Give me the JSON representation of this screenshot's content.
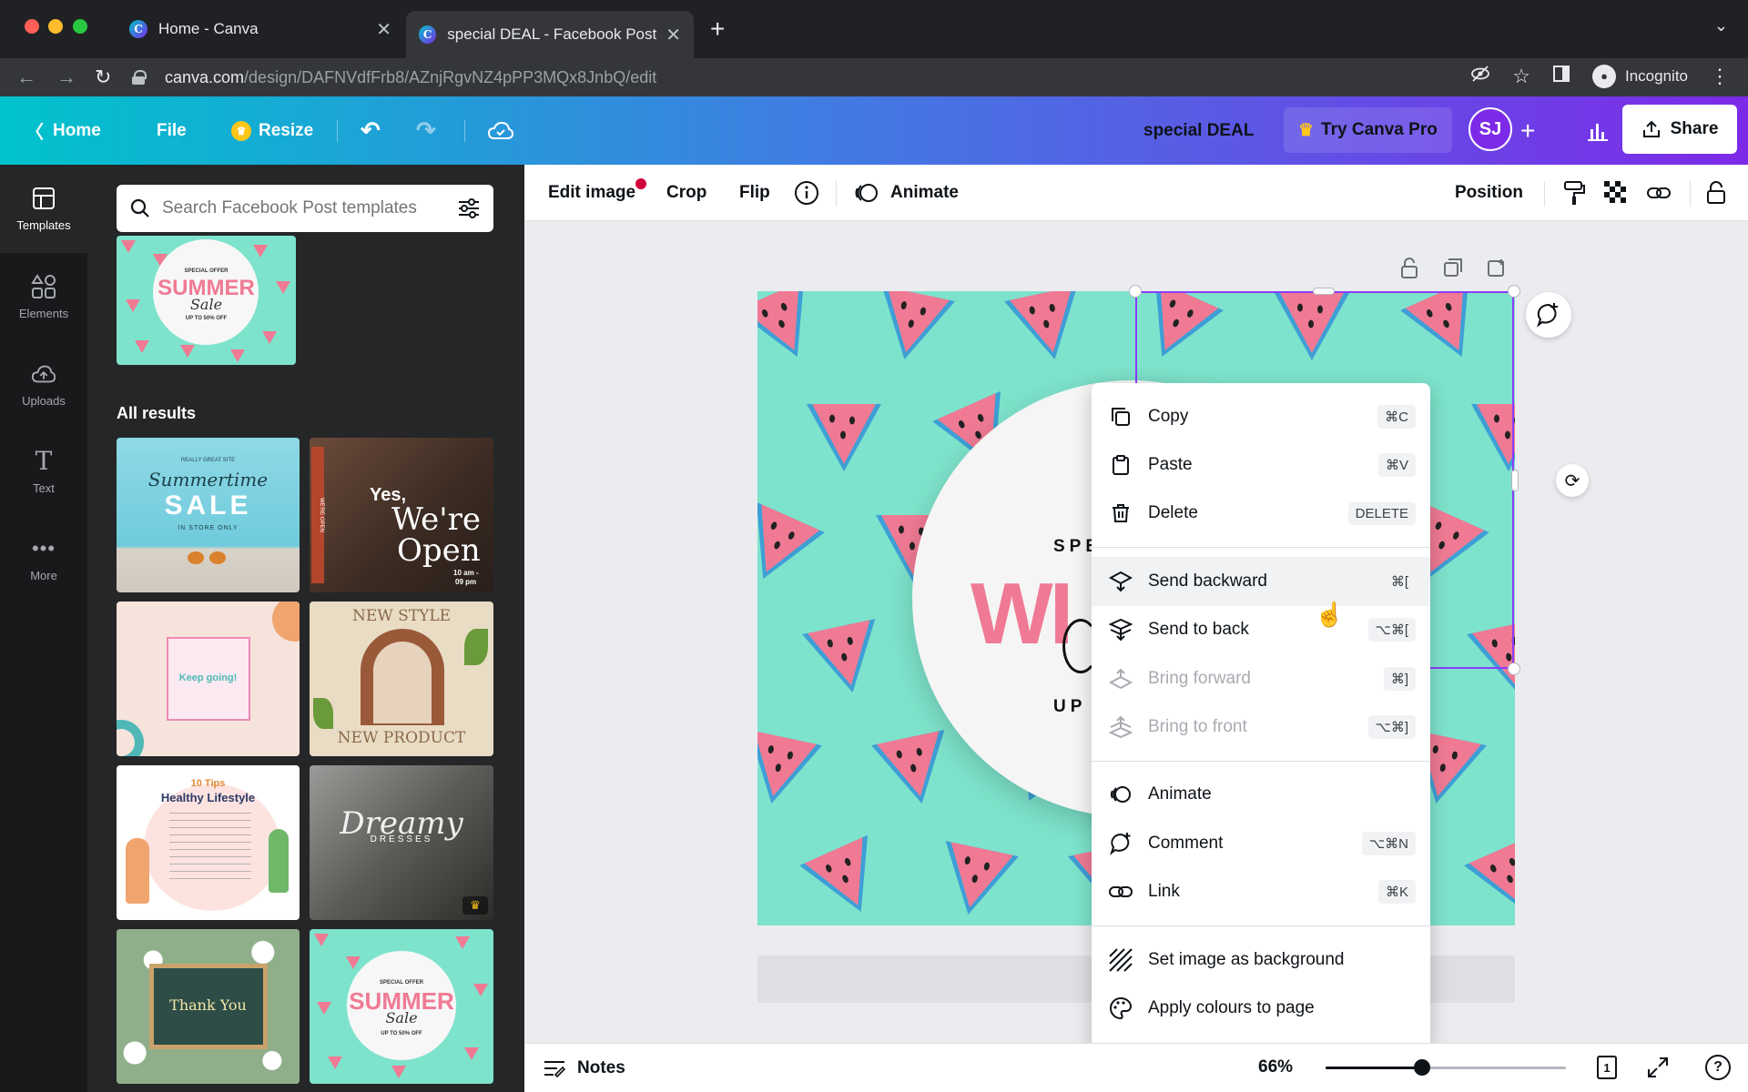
{
  "browser": {
    "tabs": [
      {
        "title": "Home - Canva",
        "active": false
      },
      {
        "title": "special DEAL - Facebook Post",
        "active": true
      }
    ],
    "url_host": "canva.com",
    "url_path": "/design/DAFNVdfFrb8/AZnjRgvNZ4pPP3MQx8JnbQ/edit",
    "profile_label": "Incognito",
    "colors": {
      "chrome_bg": "#202124",
      "chrome_tab": "#35363a"
    }
  },
  "header": {
    "home": "Home",
    "file": "File",
    "resize": "Resize",
    "design_title": "special DEAL",
    "try_pro": "Try Canva Pro",
    "avatar_initials": "SJ",
    "share": "Share",
    "gradient": [
      "#00c3cc",
      "#7d2ae8"
    ]
  },
  "rail": {
    "items": [
      {
        "label": "Templates",
        "icon": "templates-icon",
        "active": true
      },
      {
        "label": "Elements",
        "icon": "elements-icon",
        "active": false
      },
      {
        "label": "Uploads",
        "icon": "uploads-icon",
        "active": false
      },
      {
        "label": "Text",
        "icon": "text-icon",
        "active": false
      },
      {
        "label": "More",
        "icon": "more-icon",
        "active": false
      }
    ]
  },
  "panel": {
    "search_placeholder": "Search Facebook Post templates",
    "all_results": "All results",
    "thumbnails": [
      {
        "name": "summer-sale-top",
        "texts": [
          "SPECIAL OFFER",
          "SUMMER",
          "Sale",
          "UP TO 50% OFF"
        ]
      },
      {
        "name": "summertime-sale",
        "texts": [
          "REALLY GREAT SITE",
          "Summertime",
          "SALE",
          "IN STORE ONLY"
        ]
      },
      {
        "name": "were-open",
        "texts": [
          "Yes,",
          "We're",
          "Open",
          "10 am -",
          "09 pm",
          "WE'RE OPEN"
        ]
      },
      {
        "name": "keep-going",
        "texts": [
          "Keep going!"
        ]
      },
      {
        "name": "new-style",
        "texts": [
          "NEW STYLE",
          "NEW PRODUCT"
        ]
      },
      {
        "name": "healthy-lifestyle",
        "texts": [
          "10 Tips",
          "Healthy Lifestyle"
        ]
      },
      {
        "name": "dreamy-dresses",
        "texts": [
          "Dreamy",
          "DRESSES"
        ]
      },
      {
        "name": "thank-you",
        "texts": [
          "Thank You"
        ]
      },
      {
        "name": "summer-sale-bottom",
        "texts": [
          "SPECIAL OFFER",
          "SUMMER",
          "Sale",
          "UP TO 50% OFF"
        ]
      }
    ]
  },
  "toolbar": {
    "edit_image": "Edit image",
    "crop": "Crop",
    "flip": "Flip",
    "animate": "Animate",
    "position": "Position"
  },
  "canvas": {
    "design_texts": [
      "SPE",
      "WI",
      "UP"
    ],
    "colors": {
      "background": "#7ee3cc",
      "watermelon": "#f07a94",
      "rind": "#3d9fd6",
      "selection": "#8b3dff"
    }
  },
  "context_menu": {
    "groups": [
      [
        {
          "label": "Copy",
          "shortcut": "⌘C",
          "icon": "copy-icon",
          "disabled": false
        },
        {
          "label": "Paste",
          "shortcut": "⌘V",
          "icon": "paste-icon",
          "disabled": false
        },
        {
          "label": "Delete",
          "shortcut": "DELETE",
          "icon": "trash-icon",
          "disabled": false
        }
      ],
      [
        {
          "label": "Send backward",
          "shortcut": "⌘[",
          "icon": "send-backward-icon",
          "disabled": false,
          "hover": true
        },
        {
          "label": "Send to back",
          "shortcut": "⌥⌘[",
          "icon": "send-to-back-icon",
          "disabled": false
        },
        {
          "label": "Bring forward",
          "shortcut": "⌘]",
          "icon": "bring-forward-icon",
          "disabled": true
        },
        {
          "label": "Bring to front",
          "shortcut": "⌥⌘]",
          "icon": "bring-to-front-icon",
          "disabled": true
        }
      ],
      [
        {
          "label": "Animate",
          "shortcut": "",
          "icon": "animate-icon",
          "disabled": false
        },
        {
          "label": "Comment",
          "shortcut": "⌥⌘N",
          "icon": "comment-icon",
          "disabled": false
        },
        {
          "label": "Link",
          "shortcut": "⌘K",
          "icon": "link-icon",
          "disabled": false
        }
      ],
      [
        {
          "label": "Set image as background",
          "shortcut": "",
          "icon": "background-icon",
          "disabled": false
        },
        {
          "label": "Apply colours to page",
          "shortcut": "",
          "icon": "palette-icon",
          "disabled": false
        }
      ]
    ]
  },
  "bottom": {
    "notes": "Notes",
    "zoom": "66%",
    "zoom_fraction": 0.4,
    "page_number": "1",
    "help": "?"
  }
}
